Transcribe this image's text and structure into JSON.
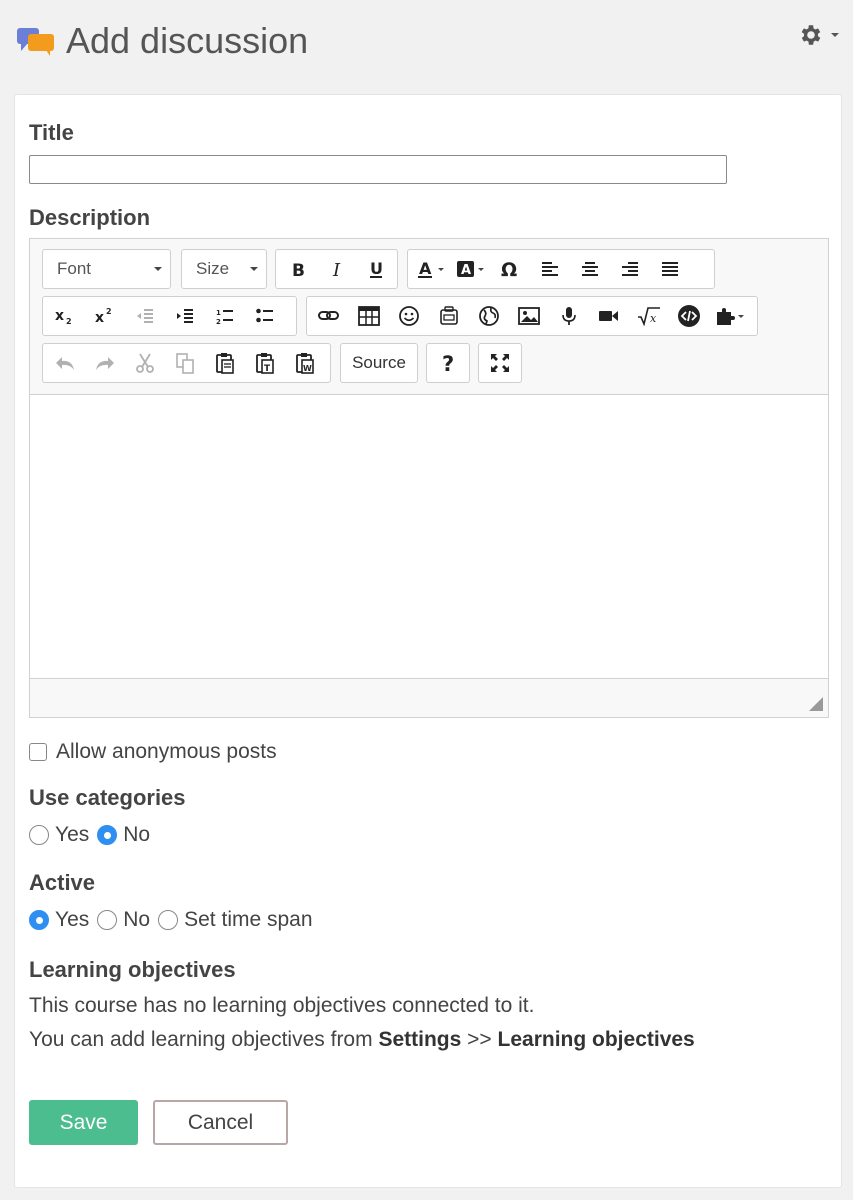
{
  "header": {
    "title": "Add discussion",
    "title_icon": "discussion-bubbles-icon",
    "settings_icon": "gear-icon"
  },
  "form": {
    "title_label": "Title",
    "title_value": "",
    "description_label": "Description",
    "editor": {
      "font_combo": "Font",
      "size_combo": "Size",
      "source_label": "Source",
      "toolbar_icons": [
        "bold",
        "italic",
        "underline",
        "text-color",
        "background-color",
        "special-character",
        "align-left",
        "align-center",
        "align-right",
        "justify",
        "subscript",
        "superscript",
        "outdent",
        "indent",
        "numbered-list",
        "bulleted-list",
        "link",
        "table",
        "smiley",
        "iframe",
        "globe",
        "image",
        "audio",
        "video",
        "math-formula",
        "embed-code",
        "plugins",
        "undo",
        "redo",
        "cut",
        "copy",
        "paste",
        "paste-as-text",
        "paste-from-word",
        "source",
        "help",
        "maximize"
      ]
    },
    "anonymous_label": "Allow anonymous posts",
    "anonymous_checked": false,
    "categories_label": "Use categories",
    "categories_options": [
      "Yes",
      "No"
    ],
    "categories_selected": "No",
    "active_label": "Active",
    "active_options": [
      "Yes",
      "No",
      "Set time span"
    ],
    "active_selected": "Yes",
    "objectives_label": "Learning objectives",
    "objectives_text": "This course has no learning objectives connected to it.",
    "objectives_hint_prefix": "You can add learning objectives from",
    "objectives_hint_settings": "Settings",
    "objectives_hint_sep": ">>",
    "objectives_hint_target": "Learning objectives",
    "save_label": "Save",
    "cancel_label": "Cancel"
  },
  "colors": {
    "save_button": "#4cbd8f",
    "radio_selected": "#2f8ff0",
    "page_background": "#f1f1f1"
  }
}
